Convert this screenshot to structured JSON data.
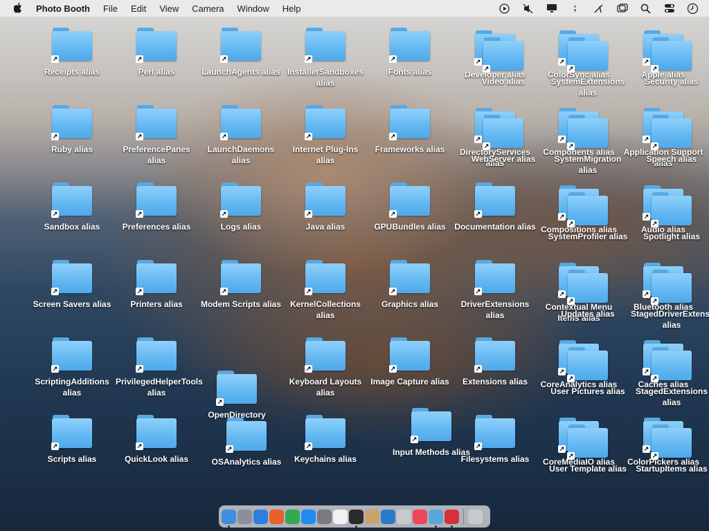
{
  "menubar": {
    "app": "Photo Booth",
    "items": [
      "File",
      "Edit",
      "View",
      "Camera",
      "Window",
      "Help"
    ],
    "status_icons": [
      "play-circle-icon",
      "mute-icon",
      "display-icon",
      "airdrop-icon",
      "no-wifi-icon",
      "window-icon",
      "search-icon",
      "control-center-icon",
      "clock-icon"
    ]
  },
  "desktop": {
    "folder_color": "#62b7f2",
    "icons": [
      "Receipts alias",
      "Perl alias",
      "LaunchAgents alias",
      "InstallerSandboxes alias",
      "Fonts alias",
      "Developer alias",
      "Video alias",
      "ColorSync alias",
      "SystemExtensions alias",
      "Apple alias",
      "Security alias",
      "Ruby alias",
      "PreferencePanes alias",
      "LaunchDaemons alias",
      "Internet Plug-Ins alias",
      "Frameworks alias",
      "DirectoryServices alias",
      "WebServer alias",
      "Components alias",
      "SystemMigration alias",
      "Application Support alias",
      "Speech alias",
      "Sandbox alias",
      "Preferences alias",
      "Logs alias",
      "Java alias",
      "GPUBundles alias",
      "Documentation alias",
      "Compositions alias",
      "SystemProfiler alias",
      "Audio alias",
      "Spotlight alias",
      "Screen Savers alias",
      "Printers alias",
      "Modem Scripts alias",
      "KernelCollections alias",
      "Graphics alias",
      "DriverExtensions alias",
      "Contextual Menu Items alias",
      "Updates alias",
      "Bluetooth alias",
      "StagedDriverExtensions alias",
      "ScriptingAdditions alias",
      "PrivilegedHelperTools alias",
      "OpenDirectory",
      "Keyboard Layouts alias",
      "Image Capture alias",
      "Extensions alias",
      "CoreAnalytics alias",
      "User Pictures alias",
      "Caches alias",
      "StagedExtensions alias",
      "Scripts alias",
      "QuickLook alias",
      "OSAnalytics alias",
      "Keychains alias",
      "Input Methods alias",
      "Filesystems alias",
      "CoreMediaIO alias",
      "User Template alias",
      "ColorPickers alias",
      "StartupItems alias"
    ]
  },
  "dock": {
    "apps": [
      {
        "name": "Finder",
        "icon": "finder-icon",
        "color": "#3d8fe0"
      },
      {
        "name": "Launchpad",
        "icon": "launchpad-icon",
        "color": "#8a8f99"
      },
      {
        "name": "Safari",
        "icon": "safari-icon",
        "color": "#2f7de1"
      },
      {
        "name": "Firefox",
        "icon": "firefox-icon",
        "color": "#e8602c"
      },
      {
        "name": "Chrome",
        "icon": "chrome-icon",
        "color": "#34a853"
      },
      {
        "name": "App Store",
        "icon": "app-store-icon",
        "color": "#1d8df0"
      },
      {
        "name": "System Preferences",
        "icon": "settings-icon",
        "color": "#7a7a80"
      },
      {
        "name": "TextEdit",
        "icon": "textedit-icon",
        "color": "#f1f1f1"
      },
      {
        "name": "Terminal",
        "icon": "terminal-icon",
        "color": "#2b2b2b"
      },
      {
        "name": "Script Editor",
        "icon": "script-editor-icon",
        "color": "#c9a36a"
      },
      {
        "name": "VS Code",
        "icon": "vscode-icon",
        "color": "#2a7ac9"
      },
      {
        "name": "Preview",
        "icon": "preview-icon",
        "color": "#c9c9c9"
      },
      {
        "name": "Music",
        "icon": "music-icon",
        "color": "#f1455a"
      },
      {
        "name": "Photo Booth Tools",
        "icon": "tools-icon",
        "color": "#58a7d9"
      },
      {
        "name": "Photo Booth",
        "icon": "photo-booth-icon",
        "color": "#d8303a"
      },
      {
        "name": "Trash",
        "icon": "trash-icon",
        "color": "#c7cbd0"
      }
    ]
  }
}
